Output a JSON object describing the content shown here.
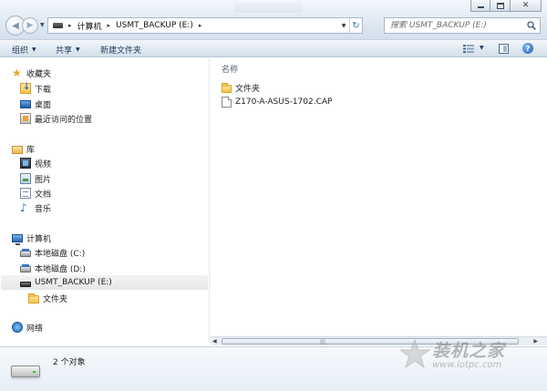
{
  "window": {
    "minimize_icon": "minimize-icon",
    "maximize_icon": "maximize-icon",
    "close_icon": "close-icon",
    "close_glyph": "✕"
  },
  "address": {
    "crumbs": [
      "计算机",
      "USMT_BACKUP (E:)"
    ],
    "separator": "▸"
  },
  "search": {
    "placeholder": "搜索 USMT_BACKUP (E:)"
  },
  "toolbar": {
    "organize": "组织",
    "share": "共享",
    "new_folder": "新建文件夹",
    "help": "?"
  },
  "sidebar": {
    "favorites": {
      "label": "收藏夹",
      "items": [
        "下载",
        "桌面",
        "最近访问的位置"
      ]
    },
    "libraries": {
      "label": "库",
      "items": [
        "视频",
        "图片",
        "文档",
        "音乐"
      ]
    },
    "computer": {
      "label": "计算机",
      "items": [
        "本地磁盘 (C:)",
        "本地磁盘 (D:)",
        "USMT_BACKUP (E:)"
      ],
      "selected_index": 2,
      "subitems": [
        "文件夹"
      ]
    },
    "network": {
      "label": "网络"
    }
  },
  "content": {
    "column_header": "名称",
    "files": [
      {
        "name": "文件夹",
        "type": "folder"
      },
      {
        "name": "Z170-A-ASUS-1702.CAP",
        "type": "file"
      }
    ]
  },
  "details": {
    "count_text": "2 个对象"
  },
  "watermark": {
    "title": "装机之家",
    "url": "www.lotpc.com"
  },
  "colors": {
    "toolbar_text": "#1e395b",
    "folder": "#f3c44a",
    "selection": "#e6e7e8"
  }
}
